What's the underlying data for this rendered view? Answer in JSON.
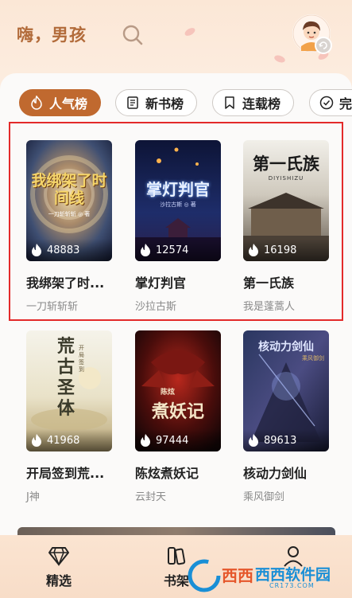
{
  "header": {
    "greeting": "嗨，男孩",
    "icons": {
      "search": "search-icon",
      "avatar": "user-avatar",
      "refresh": "refresh-icon"
    }
  },
  "tabs": [
    {
      "label": "人气榜",
      "icon": "flame-icon",
      "active": true
    },
    {
      "label": "新书榜",
      "icon": "book-icon",
      "active": false
    },
    {
      "label": "连载榜",
      "icon": "bookmark-icon",
      "active": false
    },
    {
      "label": "完",
      "icon": "check-circle-icon",
      "active": false
    }
  ],
  "books": [
    {
      "title": "我绑架了时...",
      "author": "一刀斩斩斩",
      "count": "48883",
      "cover_text": "我绑架了时间线",
      "cover_sub": "一刀斩斩斩 ◎ 著"
    },
    {
      "title": "掌灯判官",
      "author": "沙拉古斯",
      "count": "12574",
      "cover_text": "掌灯判官",
      "cover_sub": "沙拉古斯 ◎ 著"
    },
    {
      "title": "第一氏族",
      "author": "我是蓬蒿人",
      "count": "16198",
      "cover_text": "第一氏族",
      "cover_sub": "DIYISHIZU"
    },
    {
      "title": "开局签到荒...",
      "author": "J神",
      "count": "41968",
      "cover_text": "荒古圣体",
      "cover_sub": "开局签到"
    },
    {
      "title": "陈炫煮妖记",
      "author": "云封天",
      "count": "97444",
      "cover_text": "煮妖记",
      "cover_sub": "陈炫"
    },
    {
      "title": "核动力剑仙",
      "author": "乘风御剑",
      "count": "89613",
      "cover_text": "核动力剑仙",
      "cover_sub": "乘风御剑"
    }
  ],
  "nav": [
    {
      "label": "精选",
      "icon": "diamond-icon"
    },
    {
      "label": "书架",
      "icon": "bookshelf-icon"
    },
    {
      "label": "",
      "icon": "profile-icon"
    }
  ],
  "watermark": {
    "text": "西西软件园",
    "sub": "CR173.COM"
  },
  "colors": {
    "accent": "#c0692f",
    "greeting": "#b26b3a",
    "highlight": "#e32a2a"
  }
}
